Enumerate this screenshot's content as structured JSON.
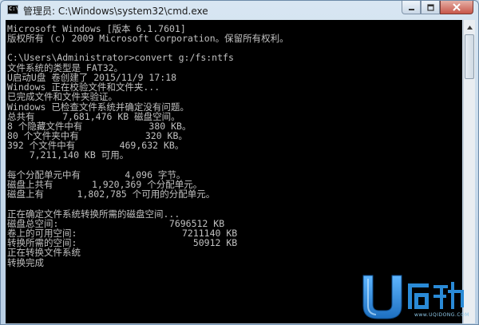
{
  "window": {
    "title": "管理员: C:\\Windows\\system32\\cmd.exe",
    "minimize_icon": "minimize-icon",
    "maximize_icon": "maximize-icon",
    "close_icon": "close-icon"
  },
  "console": {
    "lines": [
      "Microsoft Windows [版本 6.1.7601]",
      "版权所有 (c) 2009 Microsoft Corporation。保留所有权利。",
      "",
      "C:\\Users\\Administrator>convert g:/fs:ntfs",
      "文件系统的类型是 FAT32。",
      "U启动U盘 卷创建了 2015/11/9 17:18",
      "Windows 正在校验文件和文件夹...",
      "已完成文件和文件夹验证。",
      "Windows 已检查文件系统并确定没有问题。",
      "总共有     7,681,476 KB 磁盘空间。",
      "8 个隐藏文件中有            380 KB。",
      "80 个文件夹中有            320 KB。",
      "392 个文件中有        469,632 KB。",
      "    7,211,140 KB 可用。",
      "",
      "每个分配单元中有        4,096 字节。",
      "磁盘上共有       1,920,369 个分配单元。",
      "磁盘上有      1,802,785 个可用的分配单元。",
      "",
      "正在确定文件系统转换所需的磁盘空间...",
      "磁盘总空间:                    7696512 KB",
      "卷上的可用空间:                   7211140 KB",
      "转换所需的空间:                     50912 KB",
      "正在转换文件系统",
      "转换完成"
    ]
  },
  "watermark": {
    "brand": "U启动",
    "url": "www.UQIDONG.COM",
    "colors": {
      "u": "#1d6fc0",
      "text": "#2a8ad6"
    }
  }
}
